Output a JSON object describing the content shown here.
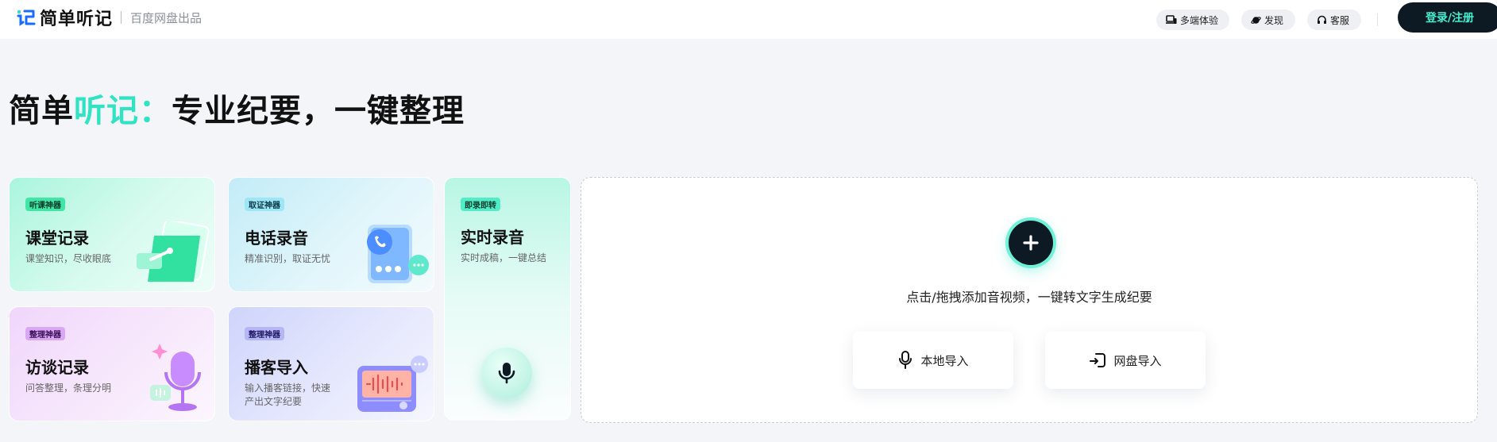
{
  "header": {
    "brand": "简单听记",
    "brand_sub": "百度网盘出品",
    "nav": [
      {
        "label": "多端体验",
        "icon": "devices-icon"
      },
      {
        "label": "发现",
        "icon": "planet-icon"
      },
      {
        "label": "客服",
        "icon": "headset-icon"
      }
    ],
    "login_label": "登录/注册"
  },
  "headline": {
    "part1": "简单",
    "part2": "听记：",
    "part3": "专业纪要，一键整理"
  },
  "cards": {
    "classroom": {
      "tag": "听课神器",
      "title": "课堂记录",
      "desc": "课堂知识，尽收眼底"
    },
    "phone": {
      "tag": "取证神器",
      "title": "电话录音",
      "desc": "精准识别，取证无忧"
    },
    "realtime": {
      "tag": "即录即转",
      "title": "实时录音",
      "desc": "实时成稿，一键总结"
    },
    "interview": {
      "tag": "整理神器",
      "title": "访谈记录",
      "desc": "问答整理，条理分明"
    },
    "podcast": {
      "tag": "整理神器",
      "title": "播客导入",
      "desc_line1": "输入播客链接，快速",
      "desc_line2": "产出文字纪要"
    }
  },
  "upload": {
    "hint": "点击/拖拽添加音视频，一键转文字生成纪要",
    "local_label": "本地导入",
    "cloud_label": "网盘导入"
  },
  "colors": {
    "accent": "#2fe3c3",
    "dark": "#0d1a24",
    "background": "#f3f5f9"
  }
}
